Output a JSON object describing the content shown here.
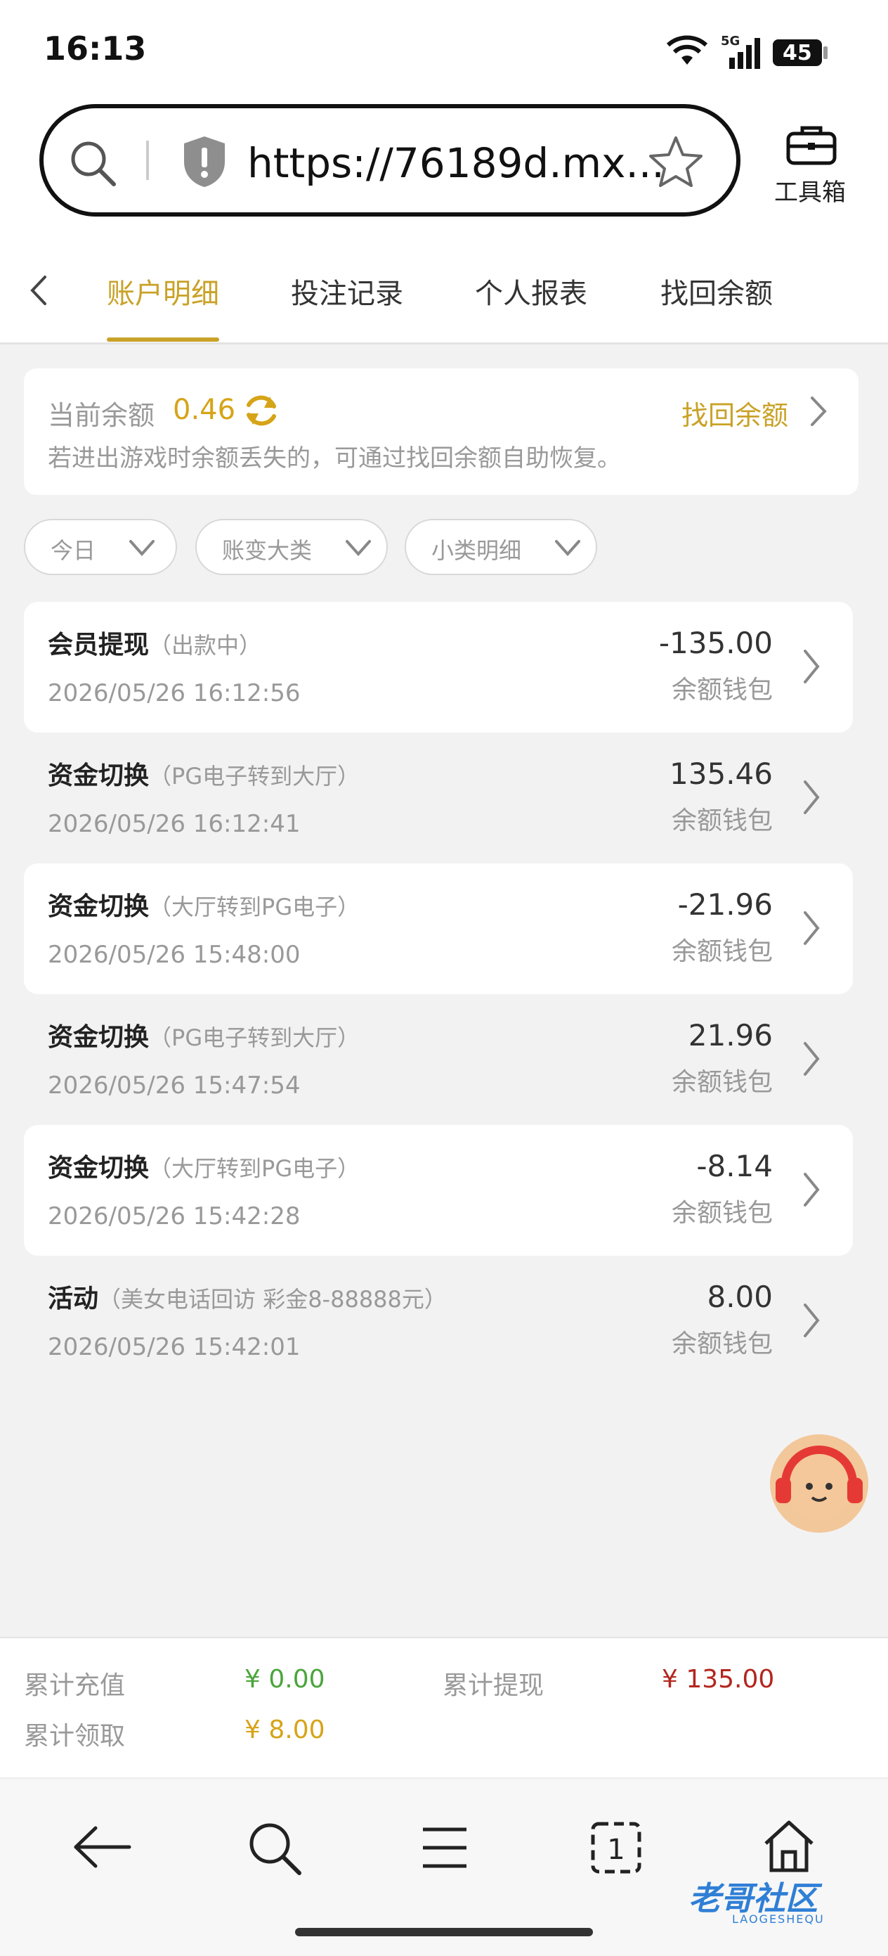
{
  "status_bar": {
    "time": "16:13",
    "network": "5G",
    "battery": "45"
  },
  "browser": {
    "url": "https://76189d.mx...",
    "toolbox_label": "工具箱"
  },
  "tabs": [
    {
      "label": "账户明细",
      "active": true
    },
    {
      "label": "投注记录",
      "active": false
    },
    {
      "label": "个人报表",
      "active": false
    },
    {
      "label": "找回余额",
      "active": false
    }
  ],
  "balance": {
    "label": "当前余额",
    "value": "0.46",
    "recover_link": "找回余额",
    "note": "若进出游戏时余额丢失的，可通过找回余额自助恢复。"
  },
  "filters": [
    {
      "label": "今日"
    },
    {
      "label": "账变大类"
    },
    {
      "label": "小类明细"
    }
  ],
  "transactions": [
    {
      "type": "会员提现",
      "detail": "（出款中）",
      "time": "2026/05/26 16:12:56",
      "amount": "-135.00",
      "wallet": "余额钱包"
    },
    {
      "type": "资金切换",
      "detail": "（PG电子转到大厅）",
      "time": "2026/05/26 16:12:41",
      "amount": "135.46",
      "wallet": "余额钱包"
    },
    {
      "type": "资金切换",
      "detail": "（大厅转到PG电子）",
      "time": "2026/05/26 15:48:00",
      "amount": "-21.96",
      "wallet": "余额钱包"
    },
    {
      "type": "资金切换",
      "detail": "（PG电子转到大厅）",
      "time": "2026/05/26 15:47:54",
      "amount": "21.96",
      "wallet": "余额钱包"
    },
    {
      "type": "资金切换",
      "detail": "（大厅转到PG电子）",
      "time": "2026/05/26 15:42:28",
      "amount": "-8.14",
      "wallet": "余额钱包"
    },
    {
      "type": "活动",
      "detail": "（美女电话回访 彩金8-88888元）",
      "time": "2026/05/26 15:42:01",
      "amount": "8.00",
      "wallet": "余额钱包"
    }
  ],
  "summary": {
    "recharge_label": "累计充值",
    "recharge_value": "¥ 0.00",
    "withdraw_label": "累计提现",
    "withdraw_value": "¥ 135.00",
    "claim_label": "累计领取",
    "claim_value": "¥ 8.00"
  },
  "colors": {
    "accent": "#c9a227",
    "green": "#4ba53b",
    "red": "#b3261e",
    "yellow": "#d6a419"
  },
  "watermark": {
    "main": "老哥社区",
    "sub": "LAOGESHEQU"
  }
}
